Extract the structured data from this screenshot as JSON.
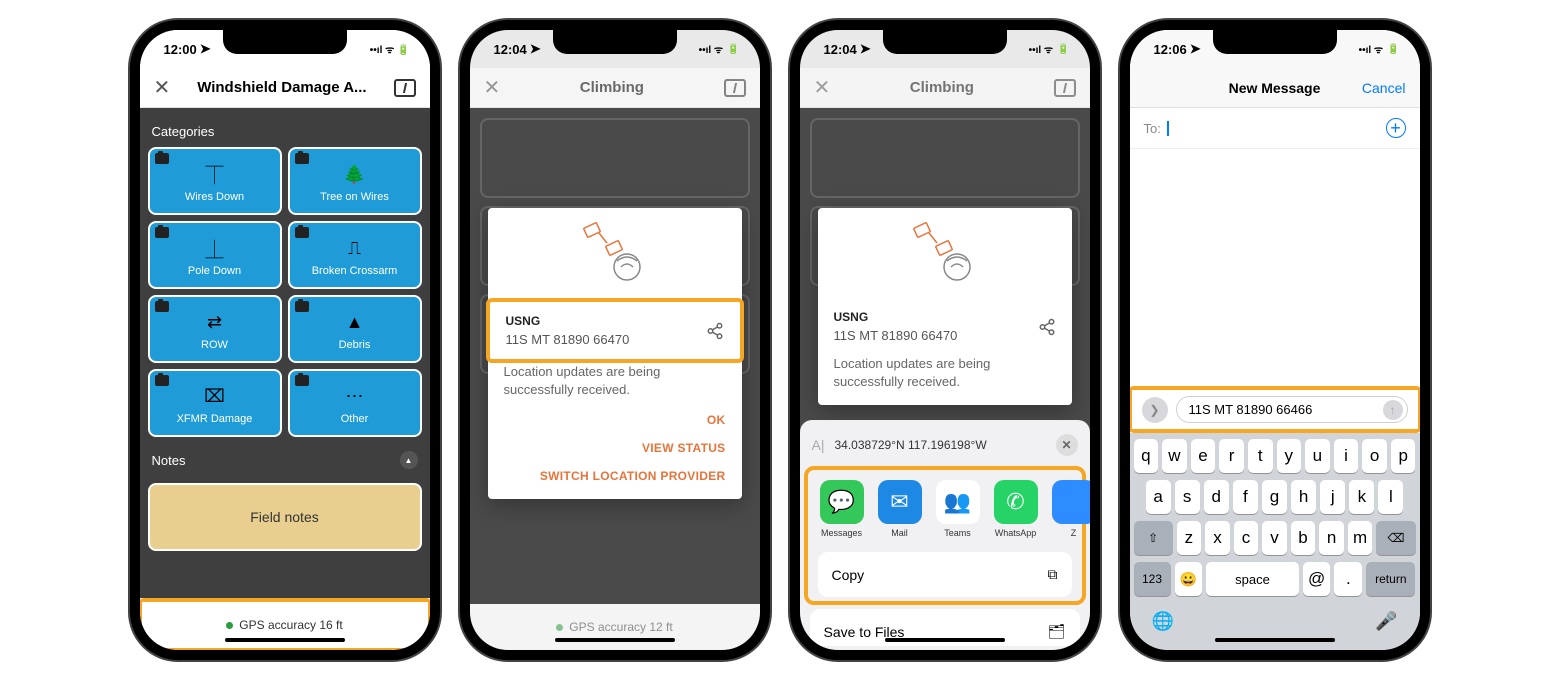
{
  "phone1": {
    "time": "12:00",
    "title": "Windshield Damage A...",
    "section_categories": "Categories",
    "section_notes": "Notes",
    "cats": [
      "Wires Down",
      "Tree on Wires",
      "Pole Down",
      "Broken Crossarm",
      "ROW",
      "Debris",
      "XFMR Damage",
      "Other"
    ],
    "cat_icons": [
      "⏉",
      "🌲",
      "⏊",
      "⎍",
      "⇄",
      "▲",
      "⌧",
      "⋯"
    ],
    "field_notes": "Field notes",
    "gps": "GPS accuracy 16 ft"
  },
  "phone2": {
    "time": "12:04",
    "title": "Climbing",
    "usng_label": "USNG",
    "usng_value": "11S MT 81890 66470",
    "loc_msg": "Location updates are being successfully received.",
    "actions": [
      "OK",
      "VIEW STATUS",
      "SWITCH LOCATION PROVIDER"
    ],
    "gps": "GPS accuracy 12 ft"
  },
  "phone3": {
    "time": "12:04",
    "title": "Climbing",
    "usng_label": "USNG",
    "usng_value": "11S MT 81890 66470",
    "loc_msg": "Location updates are being successfully received.",
    "share_coords": "34.038729°N 117.196198°W",
    "apps": [
      {
        "name": "Messages",
        "color": "#34c759",
        "icon": "💬"
      },
      {
        "name": "Mail",
        "color": "#1e88e5",
        "icon": "✉"
      },
      {
        "name": "Teams",
        "color": "#fff",
        "icon": "👥",
        "fg": "#5558af"
      },
      {
        "name": "WhatsApp",
        "color": "#25d366",
        "icon": "✆"
      },
      {
        "name": "Z",
        "color": "#2d8cff",
        "icon": ""
      }
    ],
    "copy": "Copy",
    "save": "Save to Files"
  },
  "phone4": {
    "time": "12:06",
    "title": "New Message",
    "cancel": "Cancel",
    "to_label": "To:",
    "compose_value": "11S MT 81890 66466",
    "kb_row1": [
      "q",
      "w",
      "e",
      "r",
      "t",
      "y",
      "u",
      "i",
      "o",
      "p"
    ],
    "kb_row2": [
      "a",
      "s",
      "d",
      "f",
      "g",
      "h",
      "j",
      "k",
      "l"
    ],
    "kb_row3": [
      "z",
      "x",
      "c",
      "v",
      "b",
      "n",
      "m"
    ],
    "shift": "⇧",
    "bksp": "⌫",
    "k123": "123",
    "emoji": "😀",
    "space": "space",
    "at": "@",
    "dot": ".",
    "ret": "return",
    "globe": "🌐",
    "mic": "🎤"
  }
}
